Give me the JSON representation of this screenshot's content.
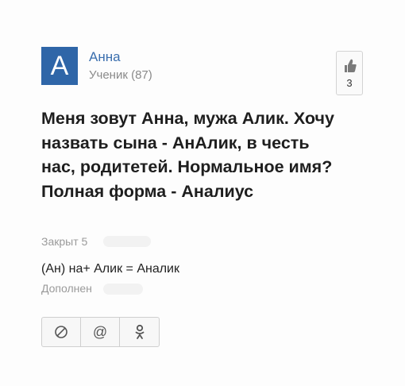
{
  "author": {
    "avatar_letter": "А",
    "name": "Анна",
    "rank": "Ученик (87)"
  },
  "likes": {
    "icon": "thumbs-up-icon",
    "count": "3"
  },
  "question": {
    "text": "Меня зовут Анна, мужа Алик. Хочу\nназвать сына - АнАлик, в честь\nнас, родитетей. Нормальное имя?\nПолная форма - Аналиус"
  },
  "status": {
    "closed": "Закрыт 5"
  },
  "answer": {
    "text": "(Ан) на+ Алик = Аналик",
    "added": "Дополнен"
  },
  "share_buttons": [
    {
      "icon": "block-icon",
      "glyph": "⊘"
    },
    {
      "icon": "at-sign-icon",
      "glyph": "@"
    },
    {
      "icon": "odnoklassniki-icon",
      "glyph": "ok"
    }
  ],
  "colors": {
    "avatar_bg": "#2f66a8",
    "name_link": "#3b6fae",
    "muted": "#9a9a9a"
  }
}
